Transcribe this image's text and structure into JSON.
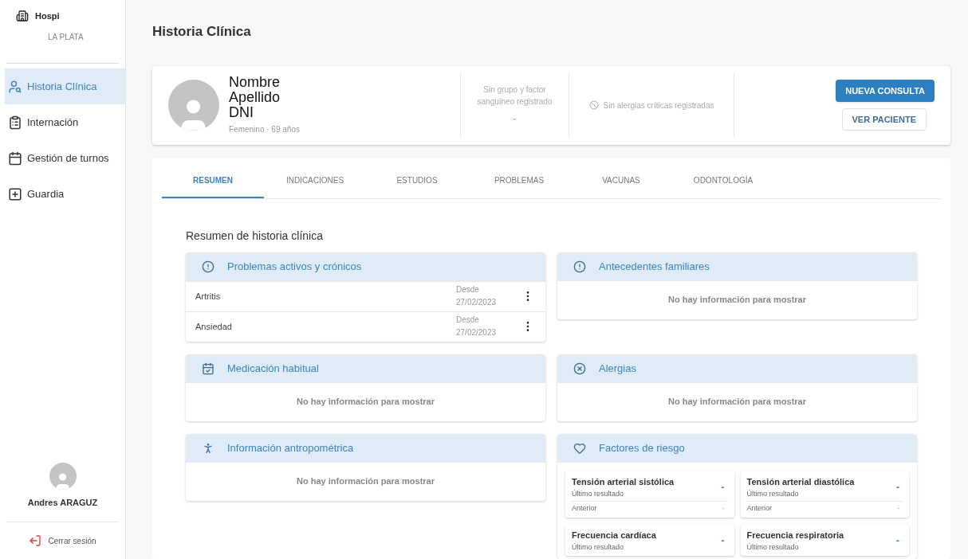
{
  "sidebar": {
    "brand": "Hospi",
    "location": "LA PLATA",
    "items": [
      {
        "label": "Historia Clínica",
        "selected": true
      },
      {
        "label": "Internación",
        "selected": false
      },
      {
        "label": "Gestión de turnos",
        "selected": false
      },
      {
        "label": "Guardia",
        "selected": false
      }
    ],
    "user": "Andres ARAGUZ",
    "logout": "Cerrar sesión"
  },
  "page_title": "Historia Clínica",
  "patient": {
    "name_lines": [
      "Nombre",
      "Apellido",
      "DNI"
    ],
    "details": "Femenino · 69 años",
    "blood": "Sin grupo y factor sanguíneo registrado",
    "blood_value": "-",
    "allergies": "Sin alergias críticas registradas",
    "primary_button": "NUEVA CONSULTA",
    "secondary_button": "VER PACIENTE"
  },
  "tabs": [
    {
      "label": "RESUMEN",
      "selected": true
    },
    {
      "label": "INDICACIONES",
      "selected": false
    },
    {
      "label": "ESTUDIOS",
      "selected": false
    },
    {
      "label": "PROBLEMAS",
      "selected": false
    },
    {
      "label": "VACUNAS",
      "selected": false
    },
    {
      "label": "ODONTOLOGÍA",
      "selected": false
    }
  ],
  "summary_title": "Resumen de historia clínica",
  "sections": [
    {
      "kind": "list",
      "title": "Problemas activos y crónicos",
      "items": [
        {
          "name": "Artritis",
          "since_label": "Desde",
          "since": "27/02/2023"
        },
        {
          "name": "Ansiedad",
          "since_label": "Desde",
          "since": "27/02/2023"
        }
      ]
    },
    {
      "kind": "empty",
      "title": "Antecedentes familiares",
      "message": "No hay información para mostrar"
    },
    {
      "kind": "empty",
      "title": "Medicación habitual",
      "message": "No hay información para mostrar"
    },
    {
      "kind": "empty",
      "title": "Alergias",
      "message": "No hay información para mostrar"
    },
    {
      "kind": "empty",
      "title": "Información antropométrica",
      "message": "No hay información para mostrar"
    },
    {
      "kind": "risk",
      "title": "Factores de riesgo",
      "factors": [
        {
          "name": "Tensión arterial sistólica",
          "value": "-",
          "last_label": "Último resultado",
          "previous_label": "Anterior",
          "previous": "-"
        },
        {
          "name": "Tensión arterial diastólica",
          "value": "-",
          "last_label": "Último resultado",
          "previous_label": "Anterior",
          "previous": "-"
        },
        {
          "name": "Frecuencia cardíaca",
          "value": "-",
          "last_label": "Último resultado"
        },
        {
          "name": "Frecuencia respiratoria",
          "value": "-",
          "last_label": "Último resultado"
        }
      ]
    }
  ]
}
